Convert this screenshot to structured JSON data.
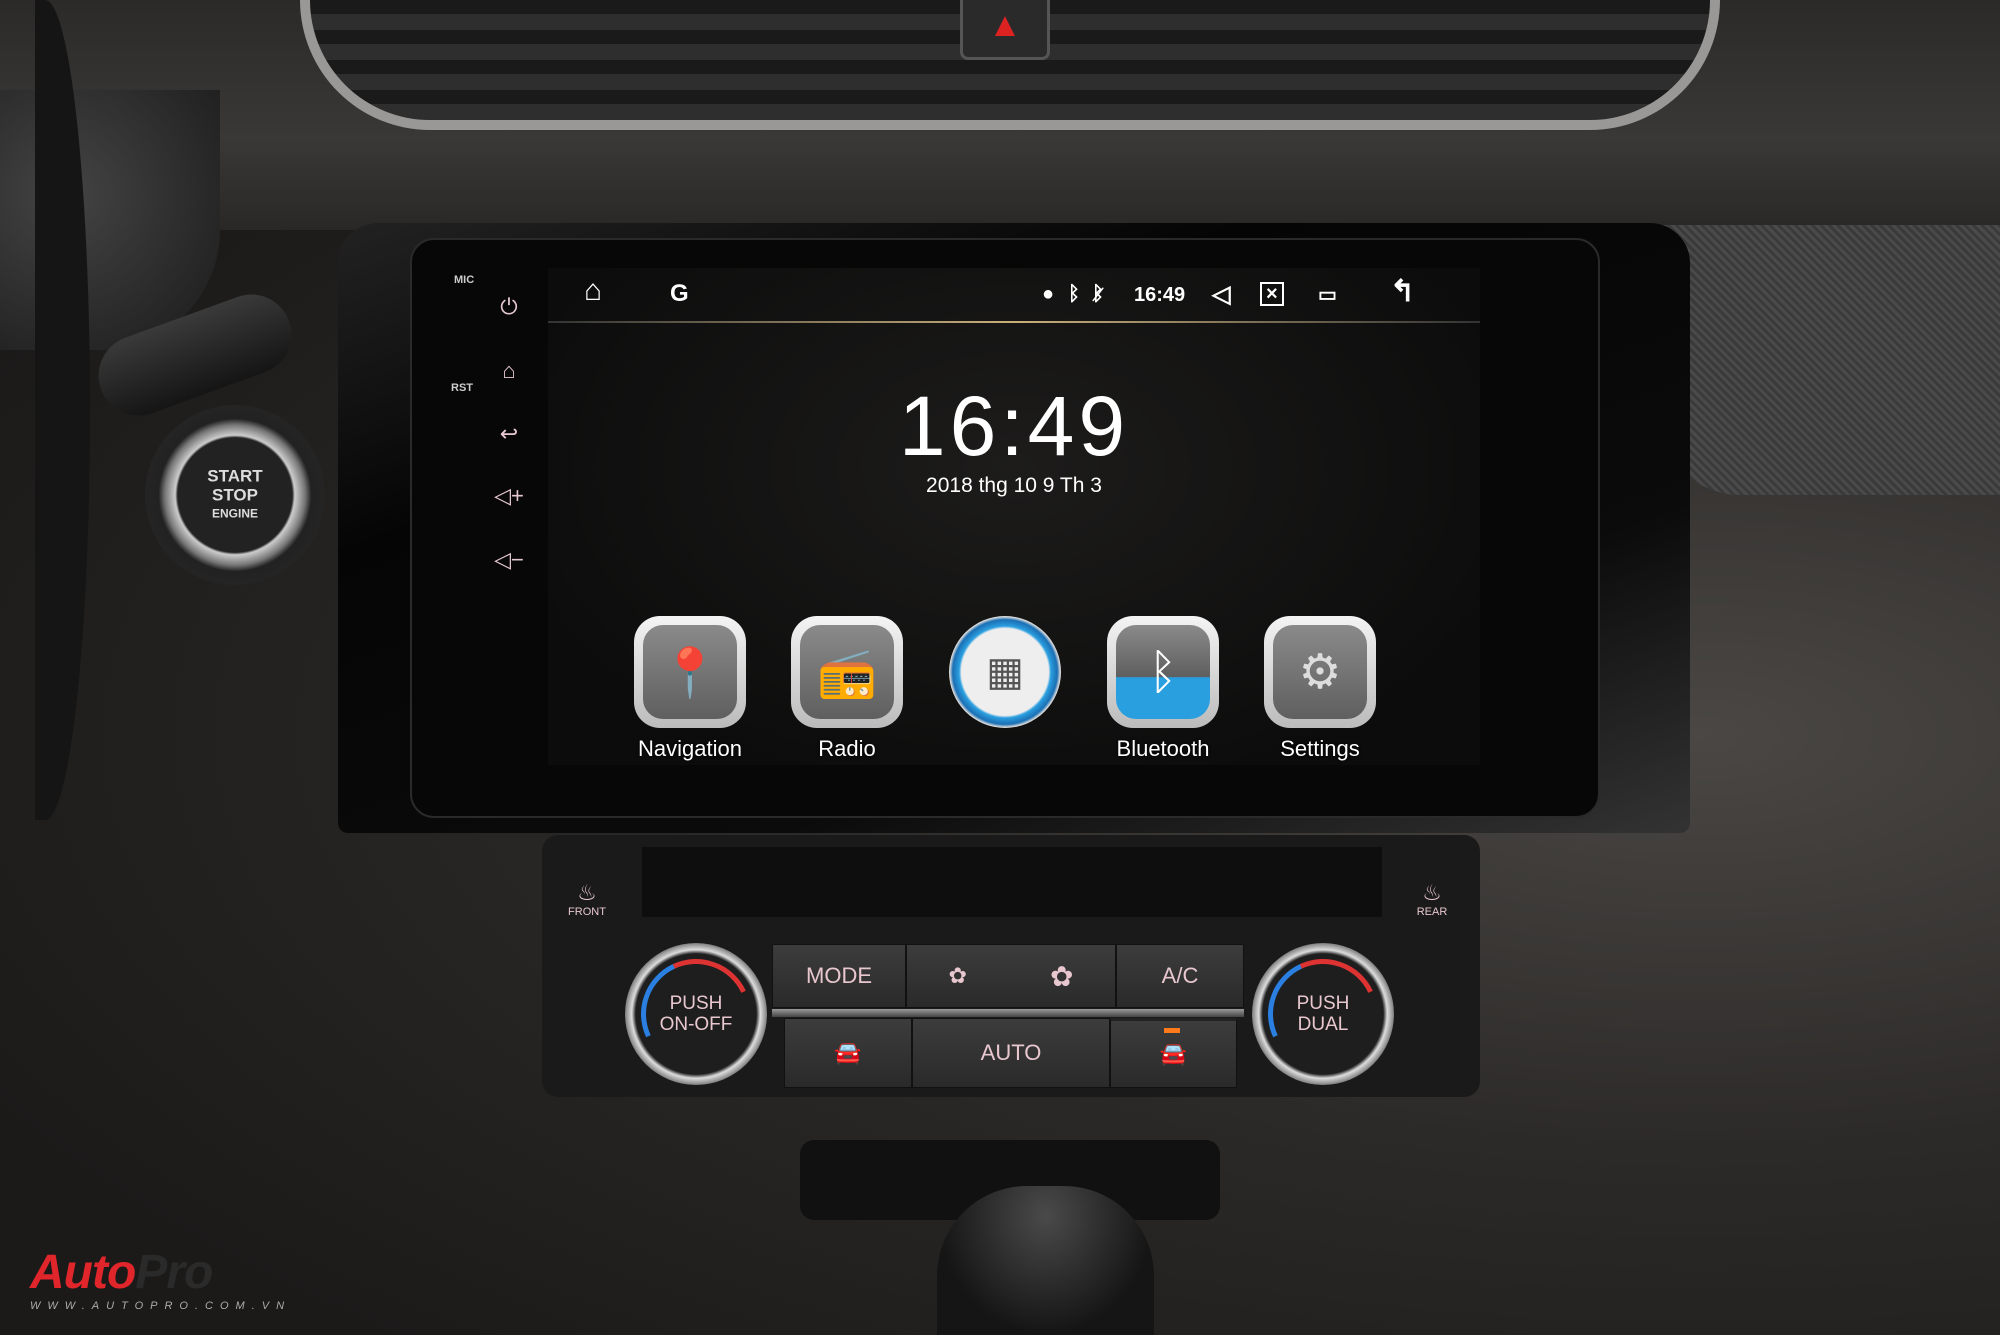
{
  "screen": {
    "status_bar": {
      "time": "16:49",
      "icons": [
        "home-icon",
        "google-icon",
        "location-icon",
        "bluetooth-icon",
        "bluetooth-off-icon",
        "volume-icon",
        "close-screen-icon",
        "window-icon",
        "back-icon"
      ]
    },
    "clock": {
      "time": "16:49",
      "date": "2018 thg 10 9 Th 3"
    },
    "apps": [
      {
        "label": "Navigation",
        "icon": "navigation-pin-icon"
      },
      {
        "label": "Radio",
        "icon": "radio-icon"
      },
      {
        "label": "",
        "icon": "apps-grid-icon"
      },
      {
        "label": "Bluetooth",
        "icon": "bluetooth-icon"
      },
      {
        "label": "Settings",
        "icon": "gears-icon"
      }
    ]
  },
  "head_unit": {
    "mic_label": "MIC",
    "rst_label": "RST",
    "buttons": [
      "power-icon",
      "home-icon",
      "back-icon",
      "volume-up-icon",
      "volume-down-icon"
    ]
  },
  "climate": {
    "front_label": "FRONT",
    "rear_label": "REAR",
    "mode": "MODE",
    "ac": "A/C",
    "auto": "AUTO",
    "left_knob": [
      "PUSH",
      "ON-OFF"
    ],
    "right_knob": [
      "PUSH",
      "DUAL"
    ]
  },
  "start_button": [
    "START",
    "STOP",
    "ENGINE"
  ],
  "watermark": {
    "brand_a": "Auto",
    "brand_b": "Pro",
    "url": "WWW.AUTOPRO.COM.VN",
    "red": "#e0262b"
  },
  "colors": {
    "accent_blue": "#2a9fe0",
    "button_text": "#e8c7cf"
  }
}
